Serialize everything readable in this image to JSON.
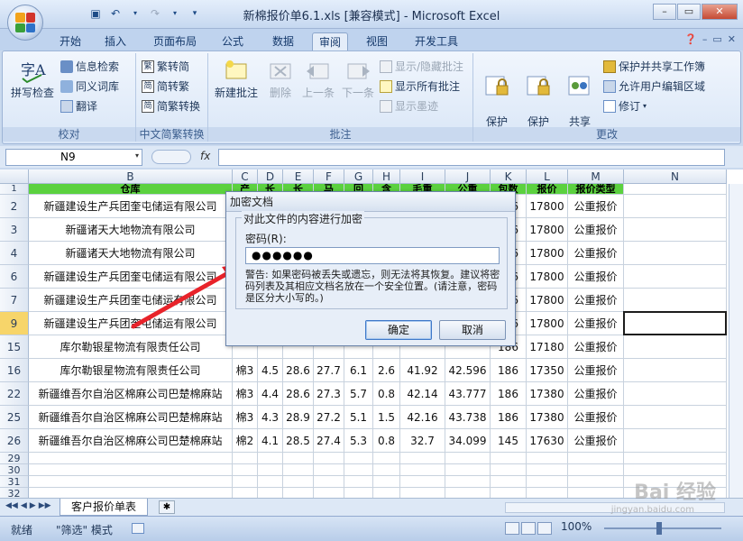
{
  "window": {
    "title": "新棉报价单6.1.xls  [兼容模式] - Microsoft Excel"
  },
  "tabs": [
    "开始",
    "插入",
    "页面布局",
    "公式",
    "数据",
    "审阅",
    "视图",
    "开发工具"
  ],
  "active_tab": "审阅",
  "ribbon": {
    "proofing": {
      "label": "校对",
      "spell": "拼写检查",
      "research": "信息检索",
      "thesaurus": "同义词库",
      "translate": "翻译"
    },
    "chinese": {
      "label": "中文简繁转换",
      "to_simplified": "繁转简",
      "to_traditional": "简转繁",
      "convert": "简繁转换"
    },
    "comments": {
      "label": "批注",
      "new_comment": "新建批注",
      "delete": "删除",
      "previous": "上一条",
      "next": "下一条",
      "show_hide": "显示/隐藏批注",
      "show_all": "显示所有批注",
      "show_ink": "显示墨迹"
    },
    "changes": {
      "label": "更改",
      "protect_sheet": "保护\n工作表",
      "protect_workbook": "保护\n工作簿",
      "share_workbook": "共享\n工作簿",
      "protect_share": "保护并共享工作簿",
      "allow_edit": "允许用户编辑区域",
      "track": "修订"
    }
  },
  "formula_bar": {
    "name_box": "N9",
    "fx": "fx",
    "value": ""
  },
  "grid": {
    "columns": [
      "B",
      "C",
      "D",
      "E",
      "F",
      "G",
      "H",
      "I",
      "J",
      "K",
      "L",
      "M",
      "N"
    ],
    "header_row": [
      "仓库",
      "产",
      "长",
      "长",
      "马",
      "回",
      "含",
      "毛重",
      "公重",
      "包数",
      "报价",
      "报价类型",
      ""
    ],
    "rows": [
      {
        "num": "2",
        "cells": [
          "新疆建设生产兵团奎屯储运有限公司",
          "",
          "",
          "",
          "",
          "",
          "",
          "",
          "",
          "186",
          "17800",
          "公重报价",
          ""
        ]
      },
      {
        "num": "3",
        "cells": [
          "新疆诸天大地物流有限公司",
          "",
          "",
          "",
          "",
          "",
          "",
          "",
          "",
          "186",
          "17800",
          "公重报价",
          ""
        ]
      },
      {
        "num": "4",
        "cells": [
          "新疆诸天大地物流有限公司",
          "",
          "",
          "",
          "",
          "",
          "",
          "",
          "",
          "186",
          "17800",
          "公重报价",
          ""
        ]
      },
      {
        "num": "6",
        "cells": [
          "新疆建设生产兵团奎屯储运有限公司",
          "",
          "",
          "",
          "",
          "",
          "",
          "",
          "",
          "186",
          "17800",
          "公重报价",
          ""
        ]
      },
      {
        "num": "7",
        "cells": [
          "新疆建设生产兵团奎屯储运有限公司",
          "",
          "",
          "",
          "",
          "",
          "",
          "",
          "",
          "186",
          "17800",
          "公重报价",
          ""
        ]
      },
      {
        "num": "9",
        "cells": [
          "新疆建设生产兵团奎屯储运有限公司",
          "",
          "",
          "",
          "",
          "",
          "",
          "",
          "",
          "186",
          "17800",
          "公重报价",
          ""
        ]
      },
      {
        "num": "15",
        "cells": [
          "库尔勒银星物流有限责任公司",
          "",
          "",
          "",
          "",
          "",
          "",
          "",
          "",
          "186",
          "17180",
          "公重报价",
          ""
        ]
      },
      {
        "num": "16",
        "cells": [
          "库尔勒银星物流有限责任公司",
          "棉3",
          "4.5",
          "28.6",
          "27.7",
          "6.1",
          "2.6",
          "41.92",
          "42.596",
          "186",
          "17350",
          "公重报价",
          ""
        ]
      },
      {
        "num": "22",
        "cells": [
          "新疆维吾尔自治区棉麻公司巴楚棉麻站",
          "棉3",
          "4.4",
          "28.6",
          "27.3",
          "5.7",
          "0.8",
          "42.14",
          "43.777",
          "186",
          "17380",
          "公重报价",
          ""
        ]
      },
      {
        "num": "25",
        "cells": [
          "新疆维吾尔自治区棉麻公司巴楚棉麻站",
          "棉3",
          "4.3",
          "28.9",
          "27.2",
          "5.1",
          "1.5",
          "42.16",
          "43.738",
          "186",
          "17380",
          "公重报价",
          ""
        ]
      },
      {
        "num": "26",
        "cells": [
          "新疆维吾尔自治区棉麻公司巴楚棉麻站",
          "棉2",
          "4.1",
          "28.5",
          "27.4",
          "5.3",
          "0.8",
          "32.7",
          "34.099",
          "145",
          "17630",
          "公重报价",
          ""
        ]
      },
      {
        "num": "29",
        "cells": [
          "",
          "",
          "",
          "",
          "",
          "",
          "",
          "",
          "",
          "",
          "",
          "",
          ""
        ]
      },
      {
        "num": "30",
        "cells": [
          "",
          "",
          "",
          "",
          "",
          "",
          "",
          "",
          "",
          "",
          "",
          "",
          ""
        ]
      },
      {
        "num": "31",
        "cells": [
          "",
          "",
          "",
          "",
          "",
          "",
          "",
          "",
          "",
          "",
          "",
          "",
          ""
        ]
      },
      {
        "num": "32",
        "cells": [
          "",
          "",
          "",
          "",
          "",
          "",
          "",
          "",
          "",
          "",
          "",
          "",
          ""
        ]
      }
    ],
    "filter_row_num": "1",
    "selected_row": "9"
  },
  "dialog": {
    "title": "加密文档",
    "legend": "对此文件的内容进行加密",
    "password_label": "密码(R):",
    "password_value": "●●●●●●",
    "warning": "警告: 如果密码被丢失或遗忘，则无法将其恢复。建议将密码列表及其相应文档名放在一个安全位置。(请注意，密码是区分大小写的。)",
    "ok": "确定",
    "cancel": "取消"
  },
  "sheet_tab": "客户报价单表",
  "status": {
    "ready": "就绪",
    "mode": "\"筛选\" 模式",
    "zoom": "100%"
  },
  "watermark": {
    "brand": "Bai 经验",
    "url": "jingyan.baidu.com"
  },
  "colors": {
    "header_fill": "#5bd13f",
    "selected_row": "#f7d56a",
    "arrow": "#e8232a"
  }
}
